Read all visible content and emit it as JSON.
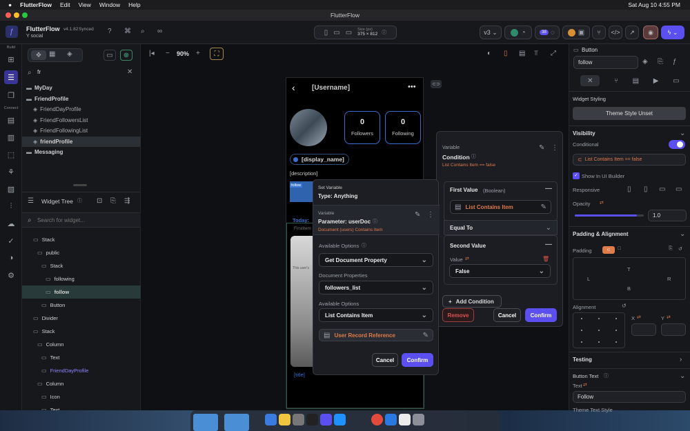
{
  "mac": {
    "apple": "",
    "app": "FlutterFlow",
    "menus": [
      "Edit",
      "View",
      "Window",
      "Help"
    ],
    "datetime": "Sat Aug 10  4:55 PM"
  },
  "window": {
    "title": "FlutterFlow"
  },
  "toolbar": {
    "brand": "FlutterFlow",
    "version": "v4.1.82",
    "synced": "Synced",
    "project": "Y social",
    "size_label": "Size (px)",
    "size_value": "375 × 812",
    "version_select": "v3",
    "badge_count": "38"
  },
  "nav": {
    "search_value": "fr",
    "rail_labels": {
      "build": "Build",
      "connect": "Connect"
    },
    "pages": [
      {
        "label": "MyDay",
        "indent": 0,
        "bold": true
      },
      {
        "label": "FriendProfile",
        "indent": 0,
        "bold": true
      },
      {
        "label": "FriendDayProfile",
        "indent": 1,
        "bold": false
      },
      {
        "label": "FriendFollowersList",
        "indent": 1,
        "bold": false
      },
      {
        "label": "FriendFollowingList",
        "indent": 1,
        "bold": false
      },
      {
        "label": "friendProfile",
        "indent": 1,
        "bold": true,
        "selected": true
      },
      {
        "label": "Messaging",
        "indent": 0,
        "bold": true
      }
    ],
    "widget_tree_title": "Widget Tree",
    "widget_search_placeholder": "Search for widget...",
    "tree": [
      {
        "label": "Stack",
        "indent": 1
      },
      {
        "label": "public",
        "indent": 2
      },
      {
        "label": "Stack",
        "indent": 3
      },
      {
        "label": "following",
        "indent": 4
      },
      {
        "label": "follow",
        "indent": 4,
        "selected": true
      },
      {
        "label": "Button",
        "indent": 3
      },
      {
        "label": "Divider",
        "indent": 1
      },
      {
        "label": "Stack",
        "indent": 1
      },
      {
        "label": "Column",
        "indent": 2
      },
      {
        "label": "Text",
        "indent": 3
      },
      {
        "label": "FriendDayProfile",
        "indent": 3,
        "accent": true
      },
      {
        "label": "Column",
        "indent": 2
      },
      {
        "label": "Icon",
        "indent": 3
      },
      {
        "label": "Text",
        "indent": 3
      }
    ]
  },
  "canvas": {
    "zoom": "90%",
    "username": "[Username]",
    "followers_count": "0",
    "followers_label": "Followers",
    "following_count": "0",
    "following_label": "Following",
    "display_name": "[display_name]",
    "description": "[description]",
    "follow_chip": "follow",
    "today": "Today:",
    "firstitem": "Firstitem",
    "card_text": "This user's",
    "title": "[title]"
  },
  "set_variable": {
    "header_label": "Set Variable",
    "type": "Type: Anything",
    "variable_label": "Variable",
    "parameter": "Parameter: userDoc",
    "doc_line": "Document (users) Contains Item",
    "opt_label_1": "Available Options",
    "opt_value_1": "Get Document Property",
    "doc_props_label": "Document Properties",
    "doc_props_value": "followers_list",
    "opt_label_2": "Available Options",
    "opt_value_2": "List Contains Item",
    "user_ref": "User Record Reference",
    "cancel": "Cancel",
    "confirm": "Confirm"
  },
  "condition": {
    "variable_label": "Variable",
    "title": "Condition",
    "subtitle": "List Contains Item  ==  false",
    "first_value_label": "First Value",
    "first_value_type": "(Boolean)",
    "first_value": "List Contains Item",
    "operator": "Equal To",
    "second_value_label": "Second Value",
    "value_label": "Value",
    "value_select": "False",
    "add_condition": "Add Condition",
    "remove": "Remove",
    "cancel": "Cancel",
    "confirm": "Confirm"
  },
  "props": {
    "widget_type": "Button",
    "name": "follow",
    "widget_styling": "Widget Styling",
    "theme_style": "Theme Style Unset",
    "visibility": "Visibility",
    "conditional": "Conditional",
    "conditional_value": "List Contains Item  ==  false",
    "show_in_builder": "Show In UI Builder",
    "responsive": "Responsive",
    "opacity_label": "Opacity",
    "opacity": "1.0",
    "opacity_level": 0.9,
    "padding_alignment": "Padding & Alignment",
    "padding": "Padding",
    "pad_t": "T",
    "pad_l": "L",
    "pad_r": "R",
    "pad_b": "B",
    "alignment": "Alignment",
    "x": "X",
    "y": "Y",
    "testing": "Testing",
    "button_text": "Button Text",
    "text_label": "Text",
    "text_value": "Follow",
    "theme_text_style": "Theme Text Style"
  },
  "colors": {
    "accent": "#5b4ff0",
    "orange": "#e07b4a",
    "blue": "#4a86d8"
  }
}
